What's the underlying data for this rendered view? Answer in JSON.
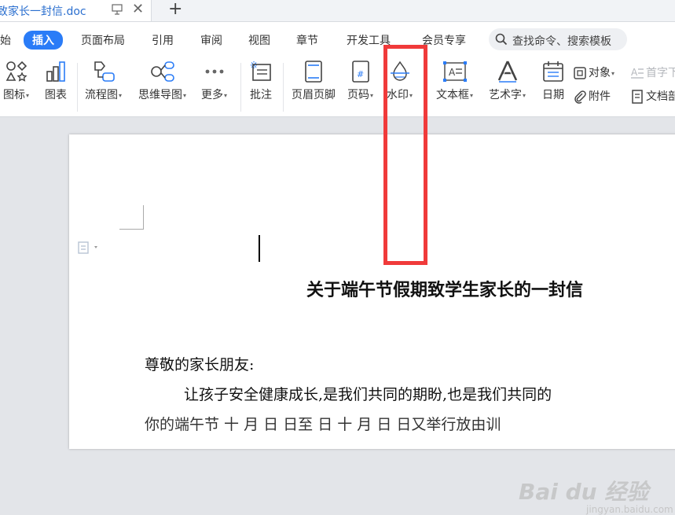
{
  "tabbar": {
    "doc_title": "致家长一封信.doc",
    "close": "✕",
    "add": "+"
  },
  "menu": {
    "tabs": [
      {
        "label": "始",
        "active": false
      },
      {
        "label": "插入",
        "active": true
      },
      {
        "label": "页面布局",
        "active": false
      },
      {
        "label": "引用",
        "active": false
      },
      {
        "label": "审阅",
        "active": false
      },
      {
        "label": "视图",
        "active": false
      },
      {
        "label": "章节",
        "active": false
      },
      {
        "label": "开发工具",
        "active": false
      },
      {
        "label": "会员专享",
        "active": false
      }
    ],
    "search_label": "查找命令、搜索模板"
  },
  "ribbon": {
    "tools": [
      {
        "label": "图标",
        "caret": true
      },
      {
        "label": "图表",
        "caret": false
      },
      {
        "label": "流程图",
        "caret": true
      },
      {
        "label": "思维导图",
        "caret": true
      },
      {
        "label": "更多",
        "caret": true
      },
      {
        "label": "批注",
        "caret": false
      },
      {
        "label": "页眉页脚",
        "caret": false
      },
      {
        "label": "页码",
        "caret": true
      },
      {
        "label": "水印",
        "caret": true
      },
      {
        "label": "文本框",
        "caret": true
      },
      {
        "label": "艺术字",
        "caret": true
      },
      {
        "label": "日期",
        "caret": false
      }
    ],
    "small_tools": {
      "object": "对象",
      "attachment": "附件",
      "dropcap": "首字下",
      "doc_parts": "文档部"
    },
    "caret_glyph": "▾"
  },
  "document": {
    "title": "关于端午节假期致学生家长的一封信",
    "greeting": "尊敬的家长朋友:",
    "body_line": "让孩子安全健康成长,是我们共同的期盼,也是我们共同的",
    "cut_line": "你的端午节 十 月 日 日至 日 十 月 日 日又举行放由训"
  },
  "branding": {
    "logo_text": "Bai du 经验",
    "sub_text": "jingyan.baidu.com"
  },
  "colors": {
    "accent": "#2a7cf7",
    "highlight": "#f03a3a",
    "tab_title": "#2b6fcf"
  }
}
